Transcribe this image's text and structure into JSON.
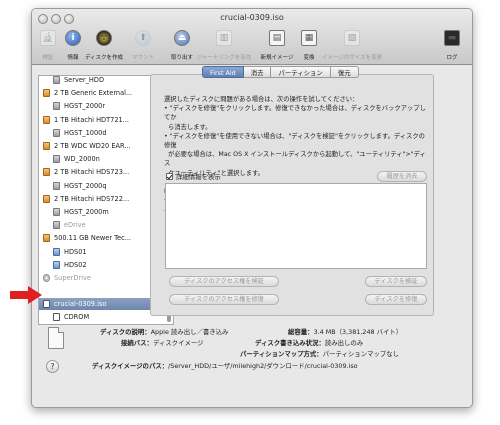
{
  "window": {
    "title": "crucial-0309.iso"
  },
  "toolbar": {
    "items": [
      {
        "label": "検証",
        "icon": "microscope-icon",
        "enabled": false
      },
      {
        "label": "情報",
        "icon": "info-icon",
        "enabled": true
      },
      {
        "label": "ディスクを作成",
        "icon": "burn-icon",
        "enabled": true
      },
      {
        "label": "マウント",
        "icon": "mount-icon",
        "enabled": false
      },
      {
        "label": "取り出す",
        "icon": "eject-icon",
        "enabled": true
      },
      {
        "label": "ジャーナリングを有効",
        "icon": "journal-icon",
        "enabled": false
      },
      {
        "label": "新規イメージ",
        "icon": "new-image-icon",
        "enabled": true
      },
      {
        "label": "変換",
        "icon": "convert-icon",
        "enabled": true
      },
      {
        "label": "イメージのサイズを変更",
        "icon": "resize-image-icon",
        "enabled": false
      },
      {
        "label": "ログ",
        "icon": "log-icon",
        "enabled": true
      }
    ]
  },
  "sidebar": {
    "items": [
      {
        "label": "Server_HDD",
        "kind": "volume",
        "indent": 1,
        "grey": false
      },
      {
        "label": "2 TB Generic External...",
        "kind": "disk",
        "indent": 0,
        "grey": false
      },
      {
        "label": "HGST_2000r",
        "kind": "volume",
        "indent": 1,
        "grey": false
      },
      {
        "label": "1 TB Hitachi HDT721...",
        "kind": "disk",
        "indent": 0,
        "grey": false
      },
      {
        "label": "HGST_1000d",
        "kind": "volume",
        "indent": 1,
        "grey": false
      },
      {
        "label": "2 TB WDC WD20 EAR...",
        "kind": "disk",
        "indent": 0,
        "grey": false
      },
      {
        "label": "WD_2000n",
        "kind": "volume",
        "indent": 1,
        "grey": false
      },
      {
        "label": "2 TB Hitachi HDS723...",
        "kind": "disk",
        "indent": 0,
        "grey": false
      },
      {
        "label": "HGST_2000q",
        "kind": "volume",
        "indent": 1,
        "grey": false
      },
      {
        "label": "2 TB Hitachi HDS722...",
        "kind": "disk",
        "indent": 0,
        "grey": false
      },
      {
        "label": "HGST_2000m",
        "kind": "volume",
        "indent": 1,
        "grey": false
      },
      {
        "label": "eDrive",
        "kind": "volume",
        "indent": 1,
        "grey": true
      },
      {
        "label": "500.11 GB Newer Tec...",
        "kind": "disk",
        "indent": 0,
        "grey": false
      },
      {
        "label": "HDS01",
        "kind": "blue",
        "indent": 1,
        "grey": false
      },
      {
        "label": "HDS02",
        "kind": "blue",
        "indent": 1,
        "grey": false
      },
      {
        "label": "SuperDrive",
        "kind": "optical",
        "indent": 0,
        "grey": true
      },
      {
        "label": "crucial-0309.iso",
        "kind": "white",
        "indent": 0,
        "grey": false,
        "selected": true
      },
      {
        "label": "CDROM",
        "kind": "white",
        "indent": 1,
        "grey": false
      }
    ]
  },
  "tabs": [
    {
      "label": "First Aid",
      "active": true
    },
    {
      "label": "消去",
      "active": false
    },
    {
      "label": "パーティション",
      "active": false
    },
    {
      "label": "復元",
      "active": false
    }
  ],
  "firstaid": {
    "description": "選択したディスクに問題がある場合は、次の操作を試してください：\n• \"ディスクを修復\"をクリックします。修復できなかった場合は、ディスクをバックアップしてか\n  ら消去します。\n• \"ディスクを修復\"を使用できない場合は、\"ディスクを検証\"をクリックします。ディスクの修復\n  が必要な場合は、Mac OS X インストールディスクから起動して、\"ユーティリティ\">\"ディス\n  クユーティリティ\"と選択します。\n\nMac OS X インストーラによってインストールされたファイルでアクセス権の問題がある場合は\n、\"ディスクのアクセス権を修復\"をクリックします。",
    "show_details": "詳細情報を表示",
    "clear_history": "履歴を消去",
    "verify_permissions": "ディスクのアクセス権を検証",
    "repair_permissions": "ディスクのアクセス権を修復",
    "verify_disk": "ディスクを検証",
    "repair_disk": "ディスクを修復"
  },
  "info": {
    "desc_key": "ディスクの説明：",
    "desc_val": "Apple 読み出し／書き込み",
    "bus_key": "接続バス：",
    "bus_val": "ディスクイメージ",
    "capacity_key": "総容量：",
    "capacity_val": "3.4 MB（3,381,248 バイト）",
    "write_key": "ディスク書き込み状況：",
    "write_val": "読み出しのみ",
    "pmap_key": "パーティションマップ方式：",
    "pmap_val": "パーティションマップなし",
    "path_key": "ディスクイメージのパス：",
    "path_val": "/Server_HDD/ユーザ/milehigh2/ダウンロード/crucial-0309.iso"
  },
  "help": {
    "label": "?"
  },
  "colors": {
    "selection": "#6d86ad",
    "active_tab": "#5d7fb6",
    "annotation_arrow": "#e02020"
  }
}
